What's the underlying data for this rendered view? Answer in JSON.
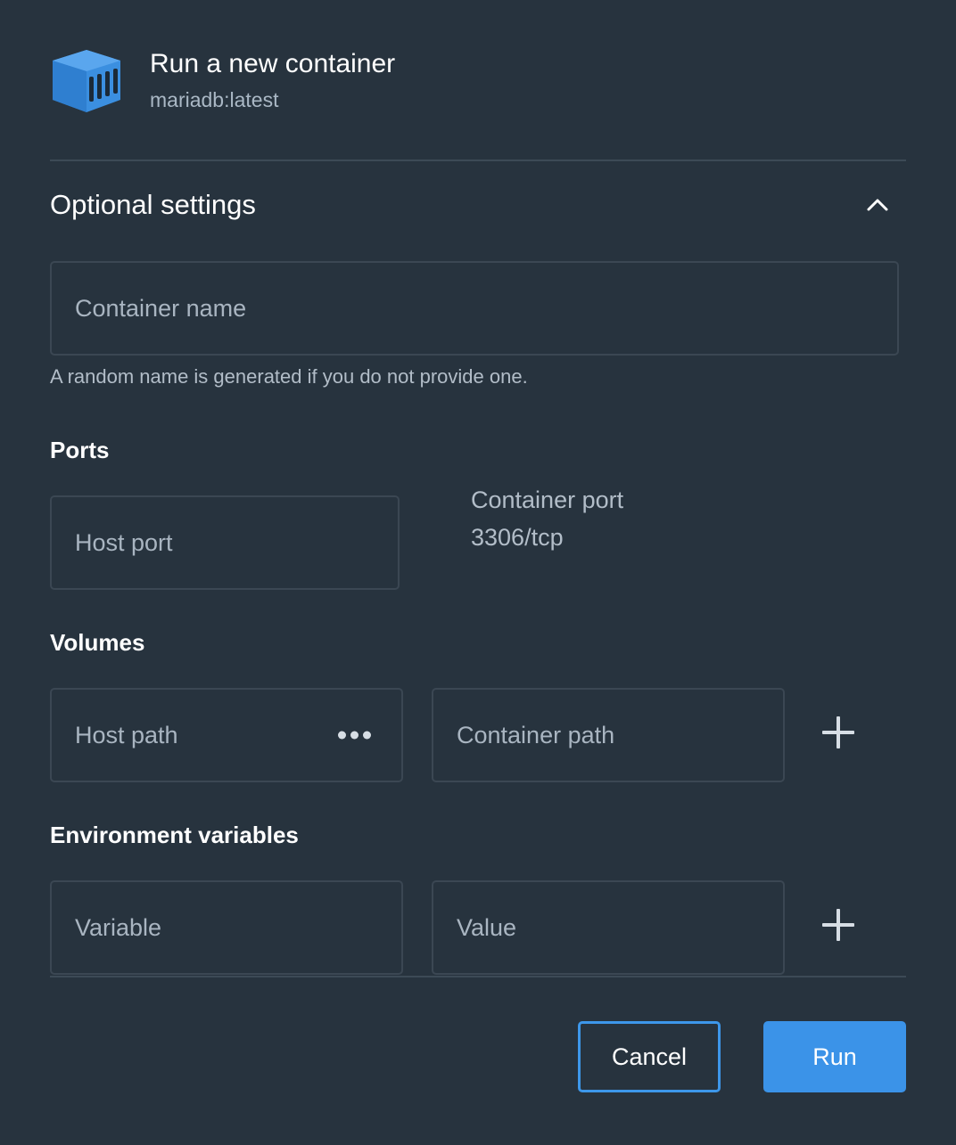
{
  "header": {
    "title": "Run a new container",
    "image": "mariadb:latest",
    "icon": "container-icon"
  },
  "optional_settings": {
    "title": "Optional settings",
    "expanded": true,
    "toggle_icon": "chevron-up-icon"
  },
  "container_name": {
    "placeholder": "Container name",
    "value": "",
    "helper": "A random name is generated if you do not provide one."
  },
  "ports": {
    "label": "Ports",
    "host_port_placeholder": "Host port",
    "container_port_label": "Container port",
    "container_port_value": "3306/tcp"
  },
  "volumes": {
    "label": "Volumes",
    "host_path_placeholder": "Host path",
    "container_path_placeholder": "Container path",
    "browse_icon": "more-horizontal-icon",
    "add_icon": "plus-icon"
  },
  "env": {
    "label": "Environment variables",
    "variable_placeholder": "Variable",
    "value_placeholder": "Value",
    "add_icon": "plus-icon"
  },
  "buttons": {
    "cancel": "Cancel",
    "run": "Run"
  },
  "colors": {
    "background": "#27333e",
    "accent": "#3b93e8",
    "border": "#3b4753"
  }
}
